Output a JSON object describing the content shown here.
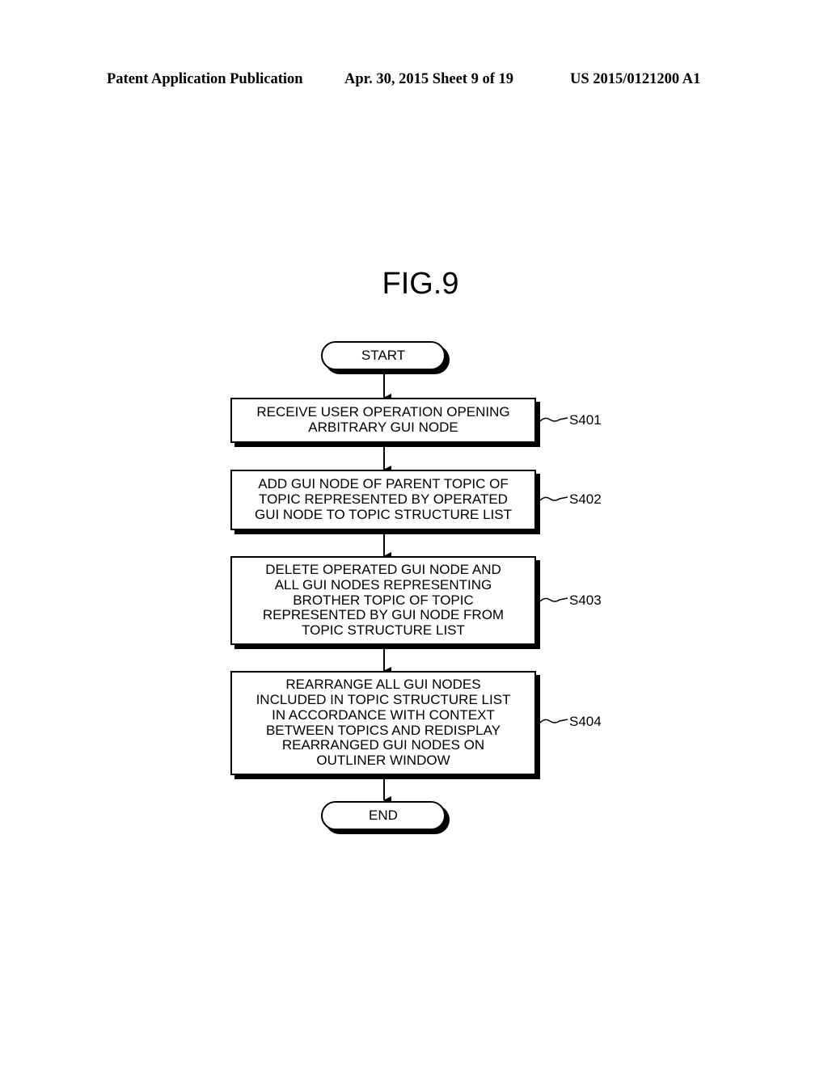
{
  "header": {
    "publication": "Patent Application Publication",
    "date_sheet": "Apr. 30, 2015  Sheet 9 of 19",
    "number": "US 2015/0121200 A1"
  },
  "figure": {
    "title": "FIG.9",
    "start": "START",
    "end": "END",
    "steps": [
      {
        "label": "S401",
        "text": "RECEIVE USER OPERATION OPENING\nARBITRARY GUI NODE"
      },
      {
        "label": "S402",
        "text": "ADD GUI NODE OF PARENT TOPIC OF\nTOPIC REPRESENTED BY OPERATED\nGUI NODE TO TOPIC STRUCTURE LIST"
      },
      {
        "label": "S403",
        "text": "DELETE OPERATED GUI NODE AND\nALL GUI NODES REPRESENTING\nBROTHER TOPIC OF TOPIC\nREPRESENTED BY GUI NODE FROM\nTOPIC STRUCTURE LIST"
      },
      {
        "label": "S404",
        "text": "REARRANGE ALL GUI NODES\nINCLUDED IN TOPIC STRUCTURE LIST\nIN ACCORDANCE WITH CONTEXT\nBETWEEN TOPICS AND REDISPLAY\nREARRANGED GUI NODES ON\nOUTLINER WINDOW"
      }
    ]
  }
}
